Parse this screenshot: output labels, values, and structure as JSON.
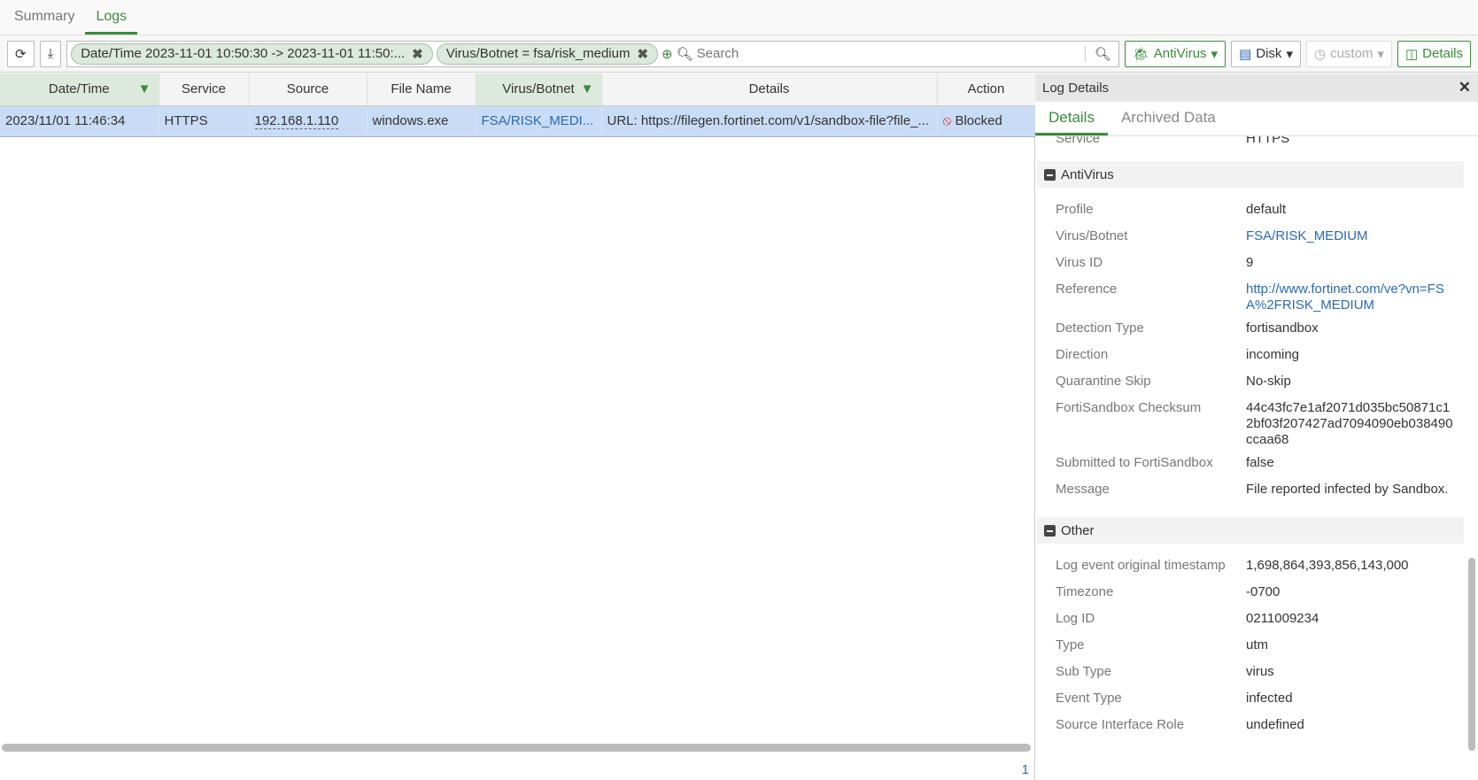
{
  "tabs": [
    "Summary",
    "Logs"
  ],
  "toolbar": {
    "filters": [
      "Date/Time 2023-11-01 10:50:30 -> 2023-11-01 11:50:...",
      "Virus/Botnet = fsa/risk_medium"
    ],
    "search_placeholder": "Search",
    "type": "AntiVirus",
    "source": "Disk",
    "time": "custom",
    "details": "Details"
  },
  "table": {
    "headers": [
      "Date/Time",
      "Service",
      "Source",
      "File Name",
      "Virus/Botnet",
      "Details",
      "Action"
    ],
    "row": [
      "2023/11/01 11:46:34",
      "HTTPS",
      "192.168.1.110",
      "windows.exe",
      "FSA/RISK_MEDI...",
      "URL: https://filegen.fortinet.com/v1/sandbox-file?file_...",
      "Blocked"
    ]
  },
  "page": "1",
  "panel": {
    "title": "Log Details",
    "tabs": [
      "Details",
      "Archived Data"
    ],
    "top": {
      "k": "Service",
      "v": "HTTPS"
    },
    "antivirus": {
      "title": "AntiVirus",
      "rows": [
        [
          "Profile",
          "default"
        ],
        [
          "Virus/Botnet",
          "FSA/RISK_MEDIUM"
        ],
        [
          "Virus ID",
          "9"
        ],
        [
          "Reference",
          "http://www.fortinet.com/ve?vn=FSA%2FRISK_MEDIUM"
        ],
        [
          "Detection Type",
          "fortisandbox"
        ],
        [
          "Direction",
          "incoming"
        ],
        [
          "Quarantine Skip",
          "No-skip"
        ],
        [
          "FortiSandbox Checksum",
          "44c43fc7e1af2071d035bc50871c12bf03f207427ad7094090eb038490ccaa68"
        ],
        [
          "Submitted to FortiSandbox",
          "false"
        ],
        [
          "Message",
          "File reported infected by Sandbox."
        ]
      ]
    },
    "other": {
      "title": "Other",
      "rows": [
        [
          "Log event original timestamp",
          "1,698,864,393,856,143,000"
        ],
        [
          "Timezone",
          "-0700"
        ],
        [
          "Log ID",
          "0211009234"
        ],
        [
          "Type",
          "utm"
        ],
        [
          "Sub Type",
          "virus"
        ],
        [
          "Event Type",
          "infected"
        ],
        [
          "Source Interface Role",
          "undefined"
        ]
      ]
    }
  }
}
